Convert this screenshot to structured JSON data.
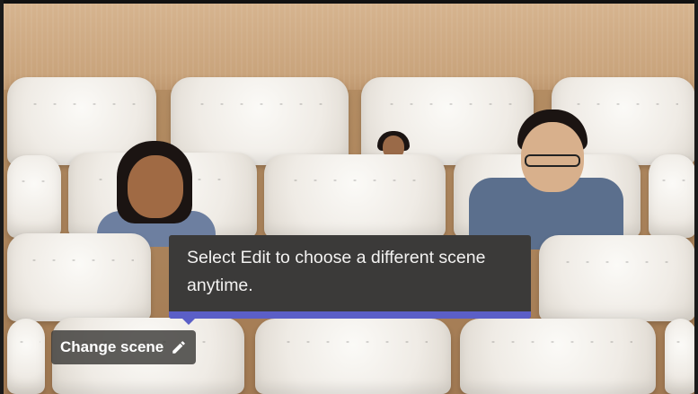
{
  "scene": {
    "name": "auditorium-seats"
  },
  "tooltip": {
    "text": "Select Edit to choose a different scene anytime."
  },
  "change_scene": {
    "label": "Change scene",
    "icon": "pencil-icon"
  },
  "colors": {
    "accent": "#5b5fc7",
    "tooltip_bg": "#3b3a39"
  }
}
